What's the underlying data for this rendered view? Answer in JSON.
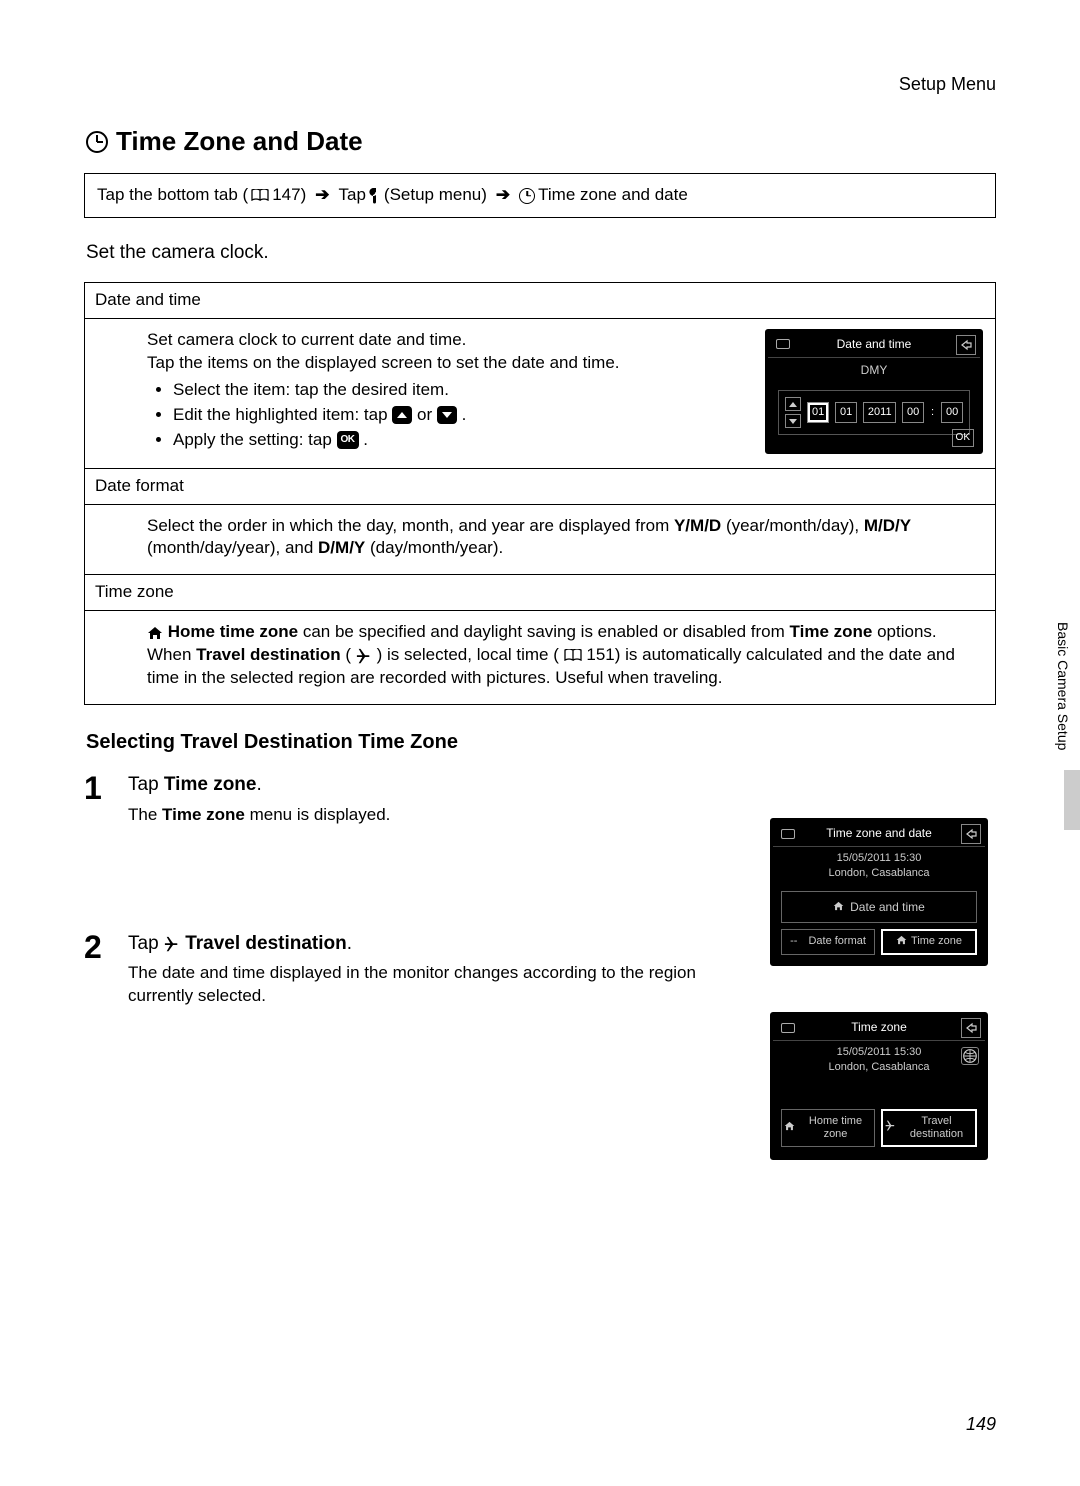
{
  "header": {
    "right": "Setup Menu"
  },
  "section": {
    "title": "Time Zone and Date"
  },
  "breadcrumb": {
    "p1": "Tap the bottom tab (",
    "ref": "147) ",
    "p2": "Tap ",
    "setup": " (Setup menu) ",
    "p3": " Time zone and date"
  },
  "intro": "Set the camera clock.",
  "opt1": {
    "head": "Date and time",
    "l1": "Set camera clock to current date and time.",
    "l2": "Tap the items on the displayed screen to set the date and time.",
    "b1": "Select the item: tap the desired item.",
    "b2a": "Edit the highlighted item: tap ",
    "b2b": " or ",
    "b2c": ".",
    "b3a": "Apply the setting: tap ",
    "b3b": "."
  },
  "opt2": {
    "head": "Date format",
    "text_a": "Select the order in which the day, month, and year are displayed from ",
    "ymd": "Y/M/D",
    "text_b": " (year/month/day), ",
    "mdy": "M/D/Y",
    "text_c": " (month/day/year), and ",
    "dmy": "D/M/Y",
    "text_d": " (day/month/year)."
  },
  "opt3": {
    "head": "Time zone",
    "b1": "Home time zone",
    "t1": " can be specified and daylight saving is enabled or disabled from ",
    "b2": "Time zone",
    "t2": " options. When ",
    "b3": "Travel destination",
    "t3": " (",
    "t4": ") is selected, local time (",
    "ref": "151) is automatically calculated and the date and time in the selected region are recorded with pictures. Useful when traveling."
  },
  "sub": "Selecting Travel Destination Time Zone",
  "step1": {
    "num": "1",
    "t1": "Tap ",
    "b1": "Time zone",
    "t2": ".",
    "d1": "The ",
    "db": "Time zone",
    "d2": " menu is displayed."
  },
  "step2": {
    "num": "2",
    "t1": "Tap ",
    "b1": " Travel destination",
    "t2": ".",
    "desc": "The date and time displayed in the monitor changes according to the region currently selected."
  },
  "screen1": {
    "title": "Date and time",
    "dmy": "DMY",
    "d": "01",
    "m": "01",
    "y": "2011",
    "h": "00",
    "min": "00",
    "ok": "OK"
  },
  "screen2": {
    "title": "Time zone and date",
    "line1": "15/05/2011  15:30",
    "line2": "London, Casablanca",
    "btn_big": "Date and time",
    "btn_a": "Date format",
    "btn_b": "Time zone",
    "dash": "--"
  },
  "screen3": {
    "title": "Time zone",
    "line1": "15/05/2011  15:30",
    "line2": "London, Casablanca",
    "btn_a": "Home time zone",
    "btn_b": "Travel destination"
  },
  "sidetab": "Basic Camera Setup",
  "pagenum": "149",
  "ok": "OK"
}
